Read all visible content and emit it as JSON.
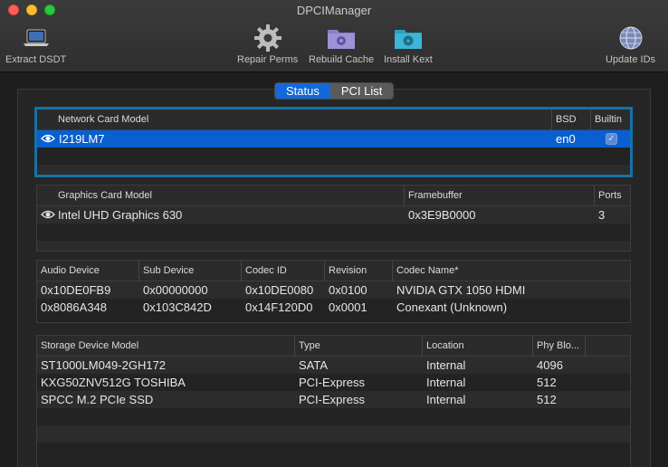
{
  "window": {
    "title": "DPCIManager"
  },
  "toolbar": {
    "extract": {
      "label": "Extract DSDT",
      "icon": "laptop-icon"
    },
    "repair": {
      "label": "Repair Perms",
      "icon": "gear-icon"
    },
    "rebuild": {
      "label": "Rebuild Cache",
      "icon": "gear-folder-icon"
    },
    "install": {
      "label": "Install Kext",
      "icon": "radiation-folder-icon"
    },
    "update": {
      "label": "Update IDs",
      "icon": "globe-icon"
    }
  },
  "tabs": {
    "status": "Status",
    "pci_list": "PCI List",
    "selected": "status"
  },
  "network": {
    "headers": {
      "model": "Network Card Model",
      "bsd": "BSD",
      "builtin": "Builtin"
    },
    "rows": [
      {
        "model": "I219LM7",
        "bsd": "en0",
        "builtin": true
      }
    ]
  },
  "graphics": {
    "headers": {
      "model": "Graphics Card Model",
      "framebuffer": "Framebuffer",
      "ports": "Ports"
    },
    "rows": [
      {
        "model": "Intel UHD Graphics 630",
        "framebuffer": "0x3E9B0000",
        "ports": "3"
      }
    ]
  },
  "audio": {
    "headers": {
      "device": "Audio Device",
      "sub": "Sub Device",
      "codec": "Codec ID",
      "revision": "Revision",
      "name": "Codec Name*"
    },
    "rows": [
      {
        "device": "0x10DE0FB9",
        "sub": "0x00000000",
        "codec": "0x10DE0080",
        "revision": "0x0100",
        "name": "NVIDIA GTX 1050 HDMI"
      },
      {
        "device": "0x8086A348",
        "sub": "0x103C842D",
        "codec": "0x14F120D0",
        "revision": "0x0001",
        "name": "Conexant (Unknown)"
      }
    ]
  },
  "storage": {
    "headers": {
      "model": "Storage Device Model",
      "type": "Type",
      "location": "Location",
      "block": "Phy Blo..."
    },
    "rows": [
      {
        "model": "ST1000LM049-2GH172",
        "type": "SATA",
        "location": "Internal",
        "block": "4096"
      },
      {
        "model": "KXG50ZNV512G TOSHIBA",
        "type": "PCI-Express",
        "location": "Internal",
        "block": "512"
      },
      {
        "model": "SPCC M.2 PCIe SSD",
        "type": "PCI-Express",
        "location": "Internal",
        "block": "512"
      }
    ]
  },
  "colors": {
    "accent": "#0a5fd0",
    "focus_ring": "#1572a8"
  }
}
